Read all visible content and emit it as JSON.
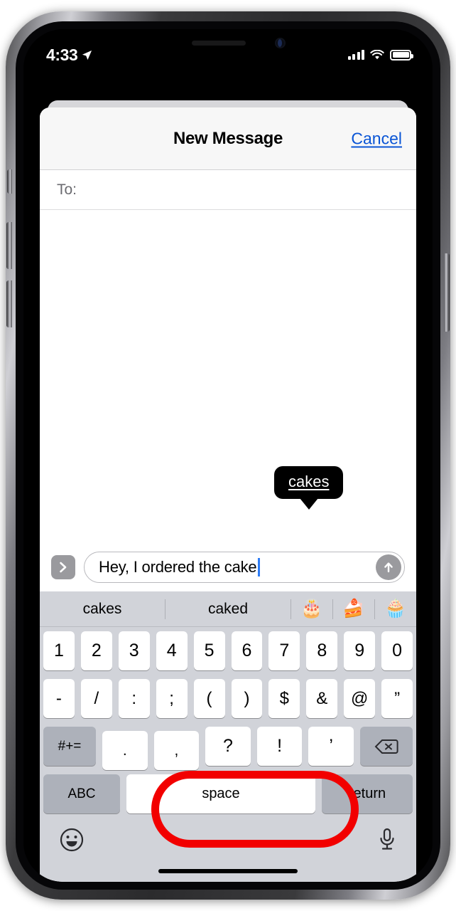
{
  "status_bar": {
    "time": "4:33",
    "location_icon": "location-arrow-icon",
    "signal_icon": "cellular-signal-icon",
    "wifi_icon": "wifi-icon",
    "battery_icon": "battery-full-icon"
  },
  "nav": {
    "title": "New Message",
    "cancel_label": "Cancel",
    "cancel_color": "#0a55d6"
  },
  "compose": {
    "to_label": "To:",
    "message_text": "Hey, I ordered the cake",
    "expand_icon": "chevron-right-icon",
    "send_icon": "send-arrow-up-icon"
  },
  "autocorrect": {
    "suggestion": "cakes"
  },
  "predictive": {
    "words": [
      "cakes",
      "caked"
    ],
    "emojis": [
      "🎂",
      "🍰",
      "🧁"
    ]
  },
  "keyboard": {
    "row_numbers": [
      "1",
      "2",
      "3",
      "4",
      "5",
      "6",
      "7",
      "8",
      "9",
      "0"
    ],
    "row_symbols": [
      "-",
      "/",
      ":",
      ";",
      "(",
      ")",
      "$",
      "&",
      "@",
      "”"
    ],
    "row_punct": [
      ".",
      ",",
      "?",
      "!",
      "’"
    ],
    "shift_symbols_label": "#+=",
    "backspace_icon": "backspace-delete-icon",
    "abc_label": "ABC",
    "space_label": "space",
    "return_label": "return",
    "emoji_icon": "smiley-face-icon",
    "dictation_icon": "microphone-icon"
  },
  "annotation": {
    "highlight_target": "space",
    "color": "#f20000"
  }
}
